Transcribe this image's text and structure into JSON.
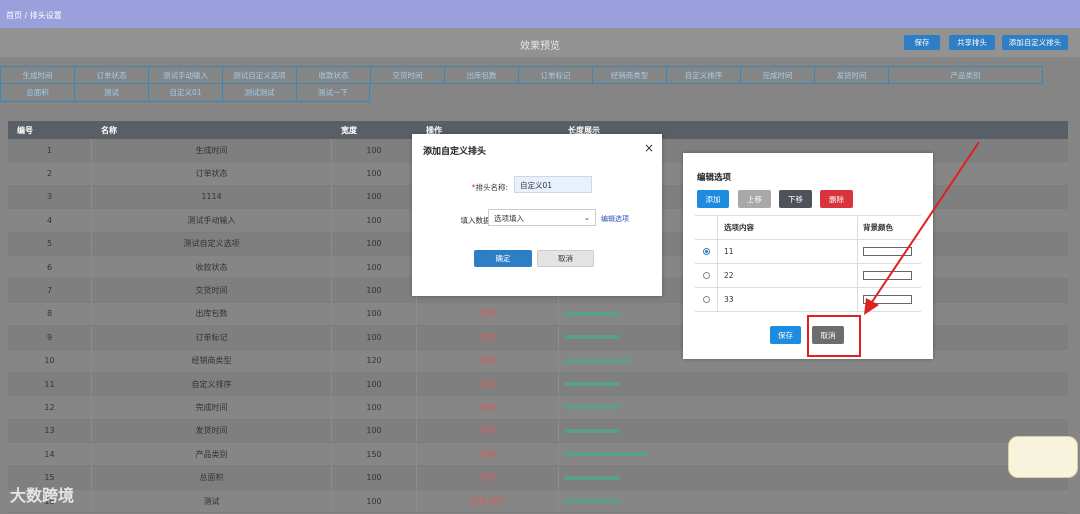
{
  "breadcrumb": "首页 / 排头设置",
  "header": {
    "title": "效果预览",
    "buttons": [
      "保存",
      "共享排头",
      "添加自定义排头"
    ]
  },
  "preview": {
    "row1": [
      "生成时间",
      "订单状态",
      "测试手动输入",
      "测试自定义选项",
      "收款状态",
      "交货时间",
      "出库包数",
      "订单标记",
      "经销商类型",
      "自定义排序",
      "完成时间",
      "发货时间",
      "产品类别"
    ],
    "row2": [
      "总面积",
      "测试",
      "自定义01",
      "测试测试",
      "测试一下"
    ]
  },
  "table": {
    "headers": [
      "编号",
      "名称",
      "宽度",
      "操作",
      "长度展示"
    ],
    "rows": [
      {
        "no": "1",
        "name": "生成时间",
        "width": "100",
        "op": "",
        "len": 0
      },
      {
        "no": "2",
        "name": "订单状态",
        "width": "100",
        "op": "",
        "len": 0
      },
      {
        "no": "3",
        "name": "1114",
        "width": "100",
        "op": "",
        "len": 0
      },
      {
        "no": "4",
        "name": "测试手动输入",
        "width": "100",
        "op": "",
        "len": 0
      },
      {
        "no": "5",
        "name": "测试自定义选项",
        "width": "100",
        "op": "",
        "len": 0
      },
      {
        "no": "6",
        "name": "收款状态",
        "width": "100",
        "op": "",
        "len": 0
      },
      {
        "no": "7",
        "name": "交货时间",
        "width": "100",
        "op": "",
        "len": 0
      },
      {
        "no": "8",
        "name": "出库包数",
        "width": "100",
        "op": "禁用",
        "len": 100
      },
      {
        "no": "9",
        "name": "订单标记",
        "width": "100",
        "op": "禁用",
        "len": 100
      },
      {
        "no": "10",
        "name": "经销商类型",
        "width": "120",
        "op": "禁用",
        "len": 120
      },
      {
        "no": "11",
        "name": "自定义排序",
        "width": "100",
        "op": "禁用",
        "len": 100
      },
      {
        "no": "12",
        "name": "完成时间",
        "width": "100",
        "op": "禁用",
        "len": 100
      },
      {
        "no": "13",
        "name": "发货时间",
        "width": "100",
        "op": "禁用",
        "len": 100
      },
      {
        "no": "14",
        "name": "产品类别",
        "width": "150",
        "op": "禁用",
        "len": 150
      },
      {
        "no": "15",
        "name": "总面积",
        "width": "100",
        "op": "禁用",
        "len": 100
      },
      {
        "no": "16",
        "name": "测试",
        "width": "100",
        "op": "禁用 删除",
        "len": 100
      }
    ]
  },
  "dialog_add": {
    "title": "添加自定义排头",
    "close": "×",
    "name_label": "排头名称:",
    "name_required": "*",
    "name_value": "自定义01",
    "type_label": "填入数据类型:",
    "type_value": "选项填入",
    "edit_link": "编辑选项",
    "ok": "确定",
    "cancel": "取消"
  },
  "dialog_options": {
    "title": "编辑选项",
    "buttons": {
      "add": "添加",
      "up": "上移",
      "down": "下移",
      "delete": "删除"
    },
    "col_option": "选项内容",
    "col_color": "背景颜色",
    "options": [
      {
        "value": "11",
        "selected": true
      },
      {
        "value": "22",
        "selected": false
      },
      {
        "value": "33",
        "selected": false
      }
    ],
    "save": "保存",
    "cancel": "取消"
  },
  "watermark": "大数跨境",
  "colors": {
    "primary": "#2d7ec4",
    "danger": "#d9343d",
    "highlight": "#e02020"
  }
}
